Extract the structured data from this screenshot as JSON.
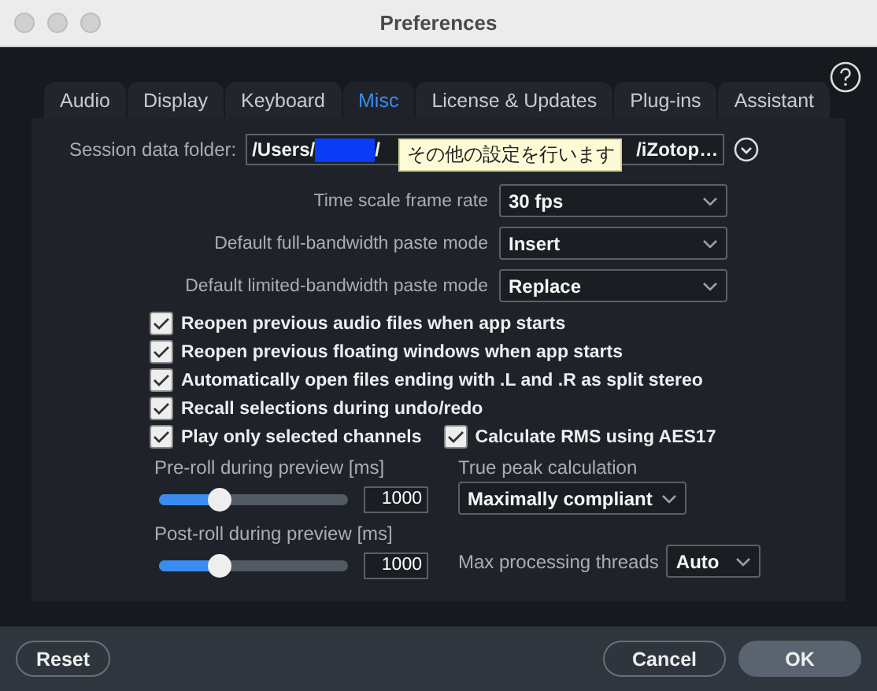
{
  "window": {
    "title": "Preferences"
  },
  "tabs": [
    {
      "label": "Audio",
      "selected": false
    },
    {
      "label": "Display",
      "selected": false
    },
    {
      "label": "Keyboard",
      "selected": false
    },
    {
      "label": "Misc",
      "selected": true
    },
    {
      "label": "License & Updates",
      "selected": false
    },
    {
      "label": "Plug-ins",
      "selected": false
    },
    {
      "label": "Assistant",
      "selected": false
    }
  ],
  "session_folder": {
    "label": "Session data folder:",
    "path_start": "/Users/",
    "path_after_redaction": "/",
    "path_end": "/iZotop…",
    "tooltip": "その他の設定を行います"
  },
  "selects": [
    {
      "label": "Time scale frame rate",
      "value": "30 fps"
    },
    {
      "label": "Default full-bandwidth paste mode",
      "value": "Insert"
    },
    {
      "label": "Default limited-bandwidth paste mode",
      "value": "Replace"
    }
  ],
  "checkboxes": [
    {
      "label": "Reopen previous audio files when app starts",
      "checked": true
    },
    {
      "label": "Reopen previous floating windows when app starts",
      "checked": true
    },
    {
      "label": "Automatically open files ending with .L and .R as split stereo",
      "checked": true
    },
    {
      "label": "Recall selections during undo/redo",
      "checked": true
    },
    {
      "label": "Play only selected channels",
      "checked": true
    },
    {
      "label": "Calculate RMS using AES17",
      "checked": true
    }
  ],
  "sliders": [
    {
      "label": "Pre-roll during preview [ms]",
      "level": 0.32,
      "value": "1000"
    },
    {
      "label": "Post-roll during preview [ms]",
      "level": 0.32,
      "value": "1000"
    }
  ],
  "true_peak": {
    "label": "True peak calculation",
    "value": "Maximally compliant"
  },
  "max_threads": {
    "label": "Max processing threads",
    "value": "Auto"
  },
  "buttons": {
    "reset": "Reset",
    "cancel": "Cancel",
    "ok": "OK"
  }
}
